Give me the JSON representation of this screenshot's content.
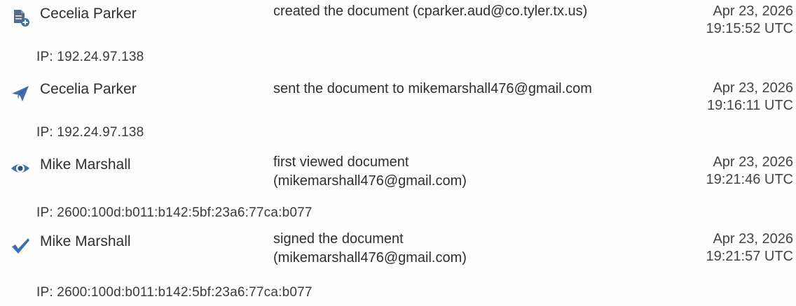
{
  "audit_trail": {
    "entries": [
      {
        "icon": "document-created-icon",
        "actor": "Cecelia Parker",
        "action_lines": [
          "created the document (cparker.aud@co.tyler.tx.us)"
        ],
        "date": "Apr 23, 2026",
        "time": "19:15:52 UTC",
        "ip": "IP: 192.24.97.138"
      },
      {
        "icon": "paper-plane-icon",
        "actor": "Cecelia Parker",
        "action_lines": [
          "sent the document to mikemarshall476@gmail.com"
        ],
        "date": "Apr 23, 2026",
        "time": "19:16:11 UTC",
        "ip": "IP: 192.24.97.138"
      },
      {
        "icon": "eye-icon",
        "actor": "Mike Marshall",
        "action_lines": [
          "first viewed document",
          "(mikemarshall476@gmail.com)"
        ],
        "date": "Apr 23, 2026",
        "time": "19:21:46 UTC",
        "ip": "IP: 2600:100d:b011:b142:5bf:23a6:77ca:b077"
      },
      {
        "icon": "checkmark-icon",
        "actor": "Mike Marshall",
        "action_lines": [
          "signed the document",
          "(mikemarshall476@gmail.com)"
        ],
        "date": "Apr 23, 2026",
        "time": "19:21:57 UTC",
        "ip": "IP: 2600:100d:b011:b142:5bf:23a6:77ca:b077"
      }
    ]
  },
  "colors": {
    "icon_blue": "#3d6fa8",
    "icon_dark": "#4b5d78",
    "text": "#2f2f2f"
  }
}
